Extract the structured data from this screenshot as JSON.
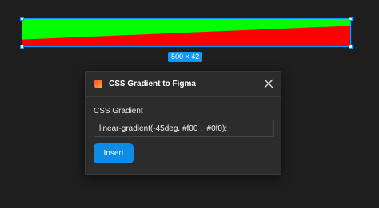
{
  "canvas": {
    "frame_size_label": "500 × 42",
    "gradient": {
      "colors": [
        "#ff0000",
        "#00ff00"
      ]
    },
    "selection_color": "#0d99ff"
  },
  "dialog": {
    "icon": "plugin-gradient-icon",
    "title": "CSS Gradient to Figma",
    "close_icon": "close-icon",
    "field_label": "CSS Gradient",
    "input_value": "linear-gradient(-45deg, #f00 ,  #0f0);",
    "insert_label": "Insert",
    "accent_color": "#0d8ce6"
  }
}
